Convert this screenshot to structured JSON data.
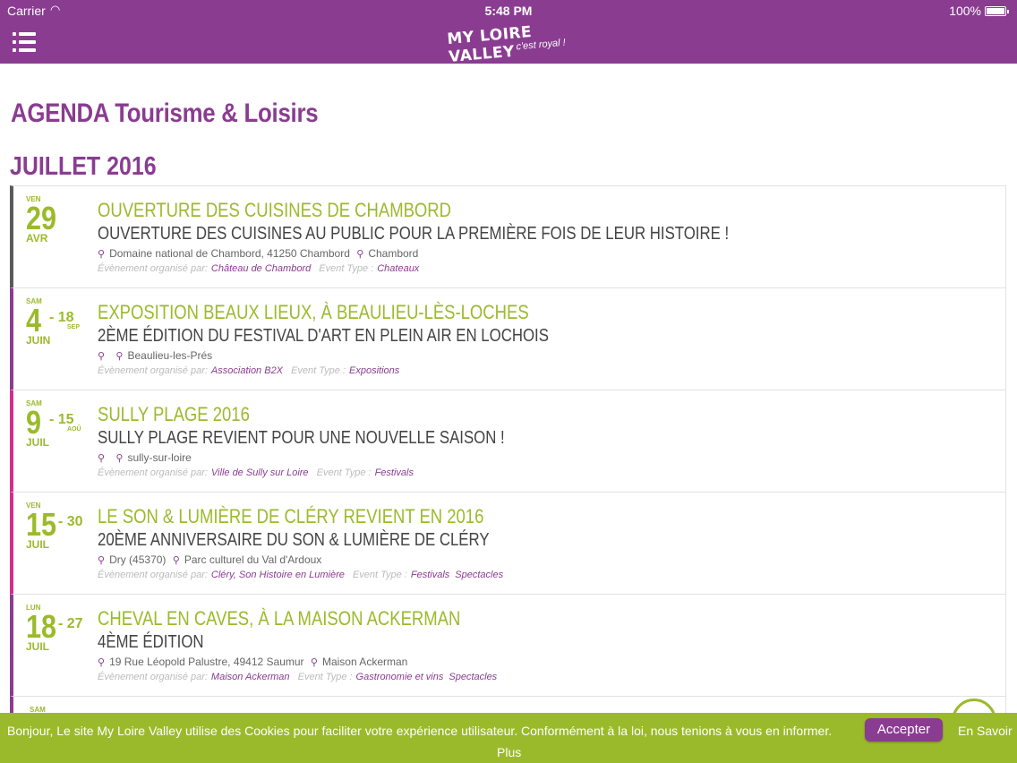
{
  "status_bar": {
    "carrier": "Carrier",
    "time": "5:48 PM",
    "battery": "100%"
  },
  "header": {
    "logo_main": "MY LOIRE VALLEY",
    "logo_sub": "c'est royal !"
  },
  "page": {
    "title": "AGENDA Tourisme & Loisirs",
    "month": "JUILLET 2016"
  },
  "events": [
    {
      "dow": "VEN",
      "day": "29",
      "end": "",
      "end_month": "",
      "month": "AVR",
      "title": "OUVERTURE DES CUISINES DE CHAMBORD",
      "subtitle": "OUVERTURE DES CUISINES AU PUBLIC POUR LA PREMIÈRE FOIS DE LEUR HISTOIRE !",
      "address": "Domaine national de Chambord, 41250 Chambord",
      "place": "Chambord",
      "organizer_label": "Évènement organisé par:",
      "organizer": "Château de Chambord",
      "type_label": "Event Type :",
      "types": [
        "Chateaux"
      ]
    },
    {
      "dow": "SAM",
      "day": "4",
      "end": "- 18",
      "end_month": "SEP",
      "month": "JUIN",
      "title": "EXPOSITION BEAUX LIEUX, À BEAULIEU-LÈS-LOCHES",
      "subtitle": "2ÈME ÉDITION DU FESTIVAL D'ART EN PLEIN AIR EN LOCHOIS",
      "address": "",
      "place": "Beaulieu-les-Prés",
      "organizer_label": "Évènement organisé par:",
      "organizer": "Association B2X",
      "type_label": "Event Type :",
      "types": [
        "Expositions"
      ]
    },
    {
      "dow": "SAM",
      "day": "9",
      "end": "- 15",
      "end_month": "AOÛ",
      "month": "JUIL",
      "title": "SULLY PLAGE 2016",
      "subtitle": "SULLY PLAGE REVIENT POUR UNE NOUVELLE SAISON !",
      "address": "",
      "place": "sully-sur-loire",
      "organizer_label": "Évènement organisé par:",
      "organizer": "Ville de Sully sur Loire",
      "type_label": "Event Type :",
      "types": [
        "Festivals"
      ]
    },
    {
      "dow": "VEN",
      "day": "15",
      "end": "- 30",
      "end_month": "",
      "month": "JUIL",
      "title": "LE SON & LUMIÈRE DE CLÉRY REVIENT EN 2016",
      "subtitle": "20ÈME ANNIVERSAIRE DU SON & LUMIÈRE DE CLÉRY",
      "address": "Dry (45370)",
      "place": "Parc culturel du Val d'Ardoux",
      "organizer_label": "Évènement organisé par:",
      "organizer": "Cléry, Son Histoire en Lumière",
      "type_label": "Event Type :",
      "types": [
        "Festivals",
        "Spectacles"
      ]
    },
    {
      "dow": "LUN",
      "day": "18",
      "end": "- 27",
      "end_month": "",
      "month": "JUIL",
      "title": "CHEVAL EN CAVES, À LA MAISON ACKERMAN",
      "subtitle": "4ÈME ÉDITION",
      "address": "19 Rue Léopold Palustre, 49412 Saumur",
      "place": "Maison Ackerman",
      "organizer_label": "Évènement organisé par:",
      "organizer": "Maison Ackerman",
      "type_label": "Event Type :",
      "types": [
        "Gastronomie et vins",
        "Spectacles"
      ]
    }
  ],
  "partial_event": {
    "dow": "SAM"
  },
  "cookie": {
    "message": "Bonjour, Le site My Loire Valley utilise des Cookies pour faciliter votre expérience utilisateur. Conformément à la loi, nous tenions à vous en informer.",
    "accept": "Accepter",
    "more_1": "En Savoir",
    "more_2": "Plus"
  },
  "colors": {
    "purple": "#8a3c91",
    "green": "#9bba2b",
    "pink": "#d32e8e"
  }
}
